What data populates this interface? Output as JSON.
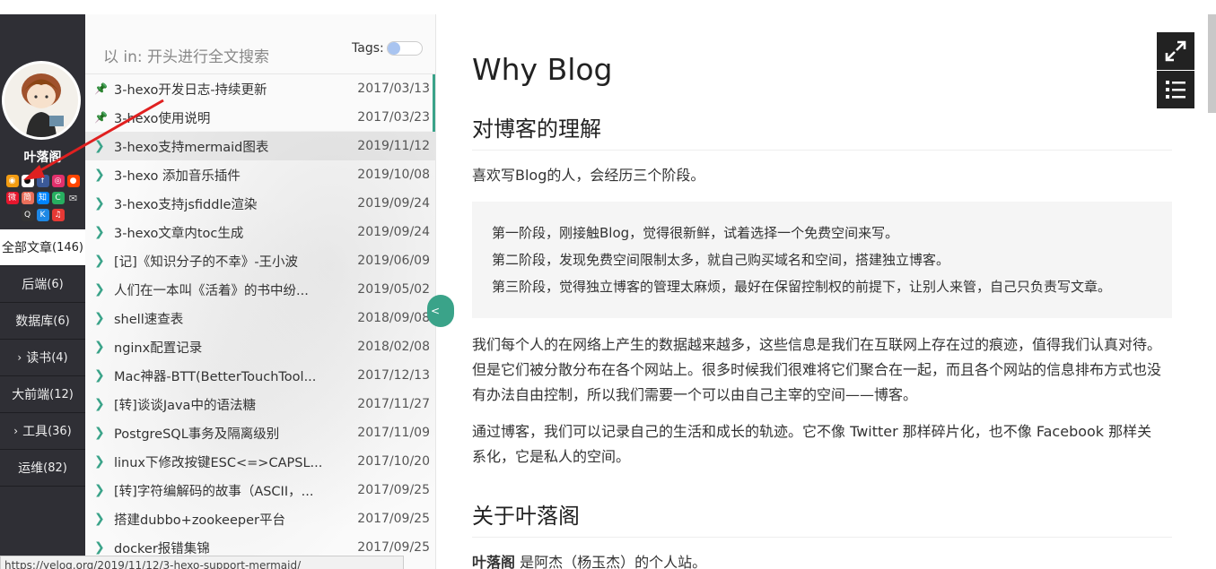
{
  "nav": {
    "author": "叶落阁",
    "menu": [
      {
        "label": "全部文章",
        "count": "(146)",
        "caret": ""
      },
      {
        "label": "后端",
        "count": "(6)",
        "caret": ""
      },
      {
        "label": "数据库",
        "count": "(6)",
        "caret": ""
      },
      {
        "label": "读书",
        "count": "(4)",
        "caret": "›"
      },
      {
        "label": "大前端",
        "count": "(12)",
        "caret": ""
      },
      {
        "label": "工具",
        "count": "(36)",
        "caret": "›"
      },
      {
        "label": "运维",
        "count": "(82)",
        "caret": ""
      }
    ],
    "social_row1": [
      "rss-icon",
      "github-icon",
      "facebook-icon",
      "instagram-icon",
      "reddit-icon"
    ],
    "social_row2": [
      "weibo-icon",
      "jianshu-icon",
      "zhihu-icon",
      "csdn-icon",
      "mail-icon"
    ],
    "social_row3": [
      "qq-icon",
      "k-icon",
      "music-icon"
    ],
    "social_row2_glyphs": [
      "微",
      "简",
      "知",
      "C",
      "✉"
    ],
    "social_row3_glyphs": [
      "Q",
      "K",
      "♫"
    ]
  },
  "list": {
    "search_placeholder": "以 in: 开头进行全文搜索",
    "tags_label": "Tags:",
    "items": [
      {
        "icon": "pin-icon",
        "title": "3-hexo开发日志-持续更新",
        "date": "2017/03/13"
      },
      {
        "icon": "pin-icon",
        "title": "3-hexo使用说明",
        "date": "2017/03/23"
      },
      {
        "icon": "chevron-right-icon",
        "title": "3-hexo支持mermaid图表",
        "date": "2019/11/12"
      },
      {
        "icon": "chevron-right-icon",
        "title": "3-hexo 添加音乐插件",
        "date": "2019/10/08"
      },
      {
        "icon": "chevron-right-icon",
        "title": "3-hexo支持jsfiddle渲染",
        "date": "2019/09/24"
      },
      {
        "icon": "chevron-right-icon",
        "title": "3-hexo文章内toc生成",
        "date": "2019/09/24"
      },
      {
        "icon": "chevron-right-icon",
        "title": "[记]《知识分子的不幸》-王小波",
        "date": "2019/06/09"
      },
      {
        "icon": "chevron-right-icon",
        "title": "人们在一本叫《活着》的书中纷...",
        "date": "2019/05/02"
      },
      {
        "icon": "chevron-right-icon",
        "title": "shell速查表",
        "date": "2018/09/08"
      },
      {
        "icon": "chevron-right-icon",
        "title": "nginx配置记录",
        "date": "2018/02/08"
      },
      {
        "icon": "chevron-right-icon",
        "title": "Mac神器-BTT(BetterTouchTool...",
        "date": "2017/12/13"
      },
      {
        "icon": "chevron-right-icon",
        "title": "[转]谈谈Java中的语法糖",
        "date": "2017/11/27"
      },
      {
        "icon": "chevron-right-icon",
        "title": "PostgreSQL事务及隔离级别",
        "date": "2017/11/09"
      },
      {
        "icon": "chevron-right-icon",
        "title": "linux下修改按键ESC<=>CAPSL...",
        "date": "2017/10/20"
      },
      {
        "icon": "chevron-right-icon",
        "title": "[转]字符编解码的故事（ASCII，...",
        "date": "2017/09/25"
      },
      {
        "icon": "chevron-right-icon",
        "title": "搭建dubbo+zookeeper平台",
        "date": "2017/09/25"
      },
      {
        "icon": "chevron-right-icon",
        "title": "docker报错集锦",
        "date": "2017/09/25"
      }
    ]
  },
  "article": {
    "title": "Why Blog",
    "h2_understanding": "对博客的理解",
    "intro": "喜欢写Blog的人，会经历三个阶段。",
    "quote": [
      "第一阶段，刚接触Blog，觉得很新鲜，试着选择一个免费空间来写。",
      "第二阶段，发现免费空间限制太多，就自己购买域名和空间，搭建独立博客。",
      "第三阶段，觉得独立博客的管理太麻烦，最好在保留控制权的前提下，让别人来管，自己只负责写文章。"
    ],
    "para1": "我们每个人的在网络上产生的数据越来越多，这些信息是我们在互联网上存在过的痕迹，值得我们认真对待。但是它们被分散分布在各个网站上。很多时候我们很难将它们聚合在一起，而且各个网站的信息排布方式也没有办法自由控制，所以我们需要一个可以由自己主宰的空间——博客。",
    "para2": "通过博客，我们可以记录自己的生活和成长的轨迹。它不像 Twitter 那样碎片化，也不像 Facebook 那样关系化，它是私人的空间。",
    "h2_about": "关于叶落阁",
    "about_bold": "叶落阁",
    "about_rest": " 是阿杰（杨玉杰）的个人站。"
  },
  "tools": {
    "expand": "expand-icon",
    "toc": "list-icon",
    "collapse_glyph": "<"
  },
  "status": {
    "url": "https://yelog.org/2019/11/12/3-hexo-support-mermaid/"
  },
  "colors": {
    "accent": "#3aa389",
    "nav_bg": "#2f2f35"
  }
}
